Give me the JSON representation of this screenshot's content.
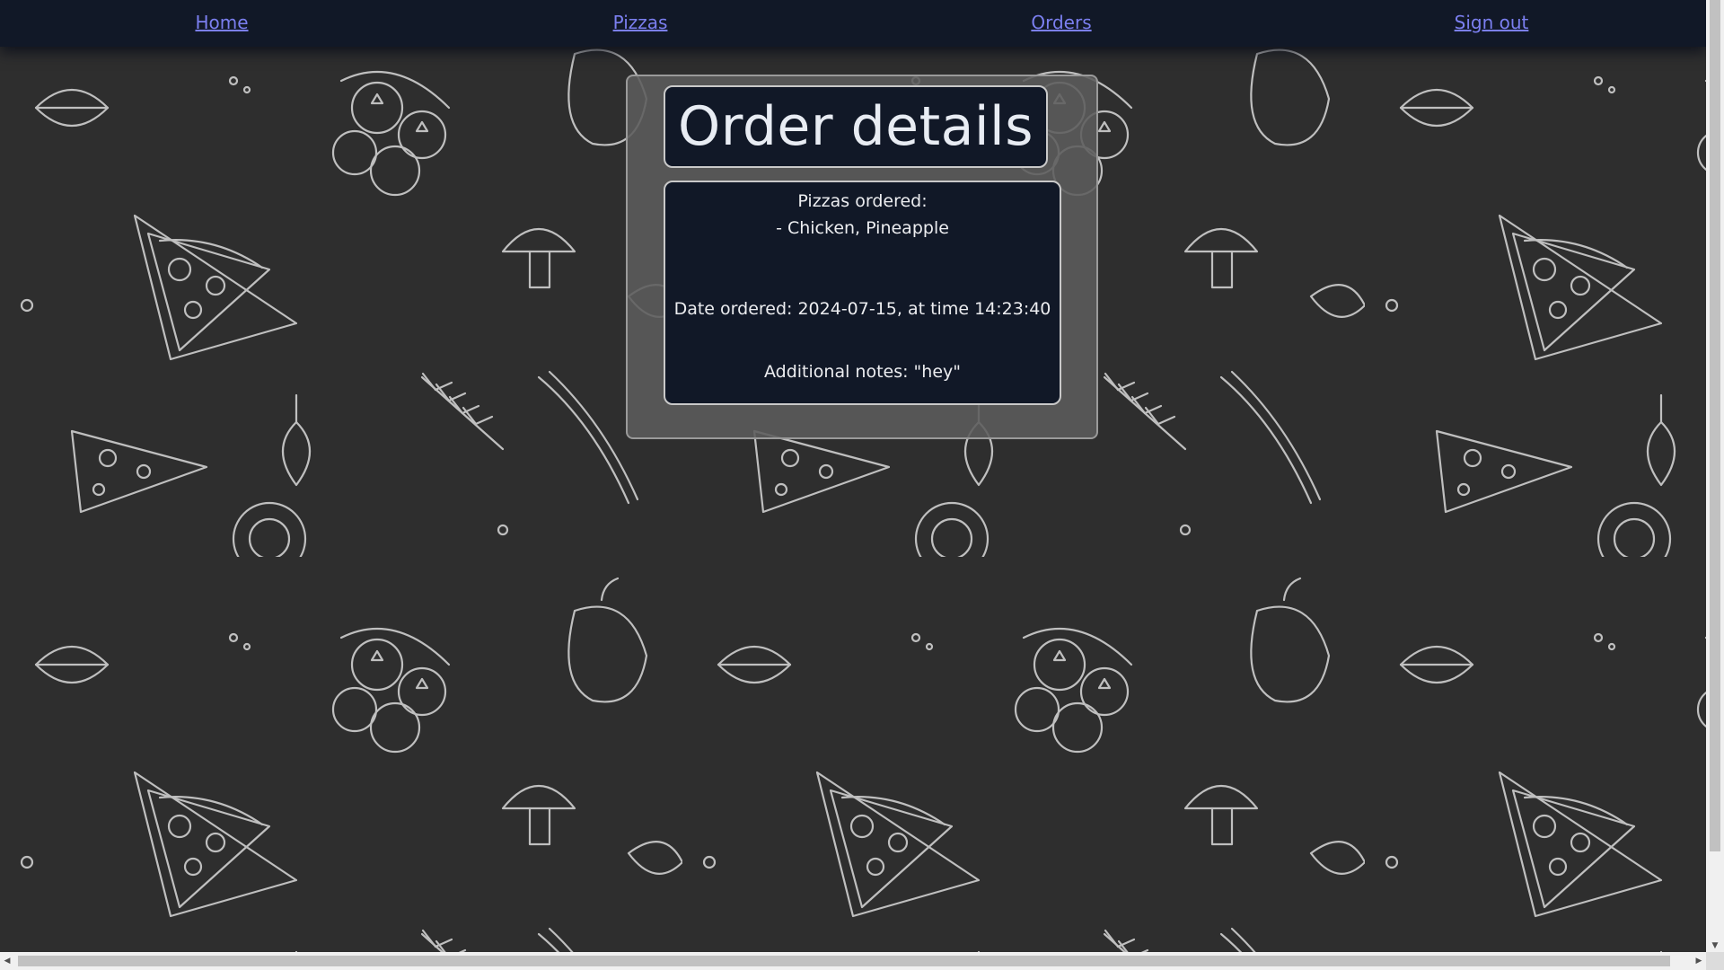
{
  "nav": {
    "home": "Home",
    "pizzas": "Pizzas",
    "orders": "Orders",
    "sign_out": "Sign out"
  },
  "order": {
    "title": "Order details",
    "pizzas_label": "Pizzas ordered:",
    "pizza_items": [
      "- Chicken, Pineapple"
    ],
    "date_line": "Date ordered: 2024-07-15, at time 14:23:40",
    "notes_line": "Additional notes: \"hey\""
  },
  "colors": {
    "navbar_bg": "#111827",
    "link": "#7b7ff0",
    "panel_bg": "#5c5c5c",
    "card_bg": "#111827",
    "page_bg": "#2e2e2e"
  },
  "icons": {
    "scroll_up": "▲",
    "scroll_down": "▼",
    "scroll_left": "◀",
    "scroll_right": "▶"
  }
}
